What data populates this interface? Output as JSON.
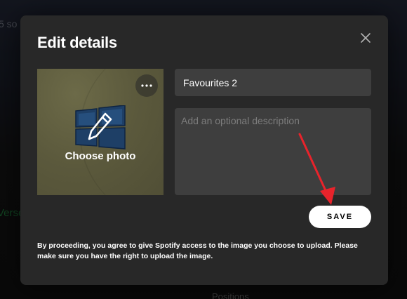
{
  "background": {
    "top_text": "5 so",
    "green_text": "Verse",
    "bottom_text": "Positions"
  },
  "modal": {
    "title": "Edit details",
    "close_icon": "close-icon",
    "photo": {
      "label": "Choose photo",
      "more_icon": "more-horizontal-icon",
      "edit_icon": "pencil-icon",
      "bg_color": "#5b593c"
    },
    "name_field": {
      "value": "Favourites 2",
      "placeholder": ""
    },
    "description_field": {
      "value": "",
      "placeholder": "Add an optional description"
    },
    "save_label": "SAVE",
    "disclaimer": "By proceeding, you agree to give Spotify access to the image you choose to upload. Please make sure you have the right to upload the image."
  },
  "colors": {
    "modal_bg": "#282828",
    "input_bg": "#3e3e3e",
    "annotation_arrow": "#e8232b"
  }
}
